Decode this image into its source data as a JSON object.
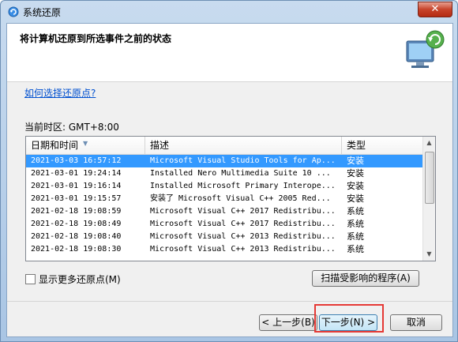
{
  "window": {
    "title": "系统还原",
    "close_label": "✕"
  },
  "header": {
    "title": "将计算机还原到所选事件之前的状态"
  },
  "help_link": "如何选择还原点?",
  "timezone": "当前时区: GMT+8:00",
  "table": {
    "columns": [
      "日期和时间",
      "描述",
      "类型"
    ],
    "rows": [
      {
        "date": "2021-03-03 16:57:12",
        "desc": "Microsoft Visual Studio Tools for Ap...",
        "type": "安装",
        "selected": true
      },
      {
        "date": "2021-03-01 19:24:14",
        "desc": "Installed Nero Multimedia Suite 10 ...",
        "type": "安装"
      },
      {
        "date": "2021-03-01 19:16:14",
        "desc": "Installed Microsoft Primary Interope...",
        "type": "安装"
      },
      {
        "date": "2021-03-01 19:15:57",
        "desc": "安装了 Microsoft Visual C++ 2005 Red...",
        "type": "安装"
      },
      {
        "date": "2021-02-18 19:08:59",
        "desc": "Microsoft Visual C++ 2017 Redistribu...",
        "type": "系统"
      },
      {
        "date": "2021-02-18 19:08:49",
        "desc": "Microsoft Visual C++ 2017 Redistribu...",
        "type": "系统"
      },
      {
        "date": "2021-02-18 19:08:40",
        "desc": "Microsoft Visual C++ 2013 Redistribu...",
        "type": "系统"
      },
      {
        "date": "2021-02-18 19:08:30",
        "desc": "Microsoft Visual C++ 2013 Redistribu...",
        "type": "系统"
      }
    ]
  },
  "show_more_label": "显示更多还原点(M)",
  "buttons": {
    "scan": "扫描受影响的程序(A)",
    "back": "< 上一步(B)",
    "next": "下一步(N) >",
    "cancel": "取消"
  },
  "colors": {
    "selection": "#3399ff",
    "highlight": "#e53935"
  }
}
